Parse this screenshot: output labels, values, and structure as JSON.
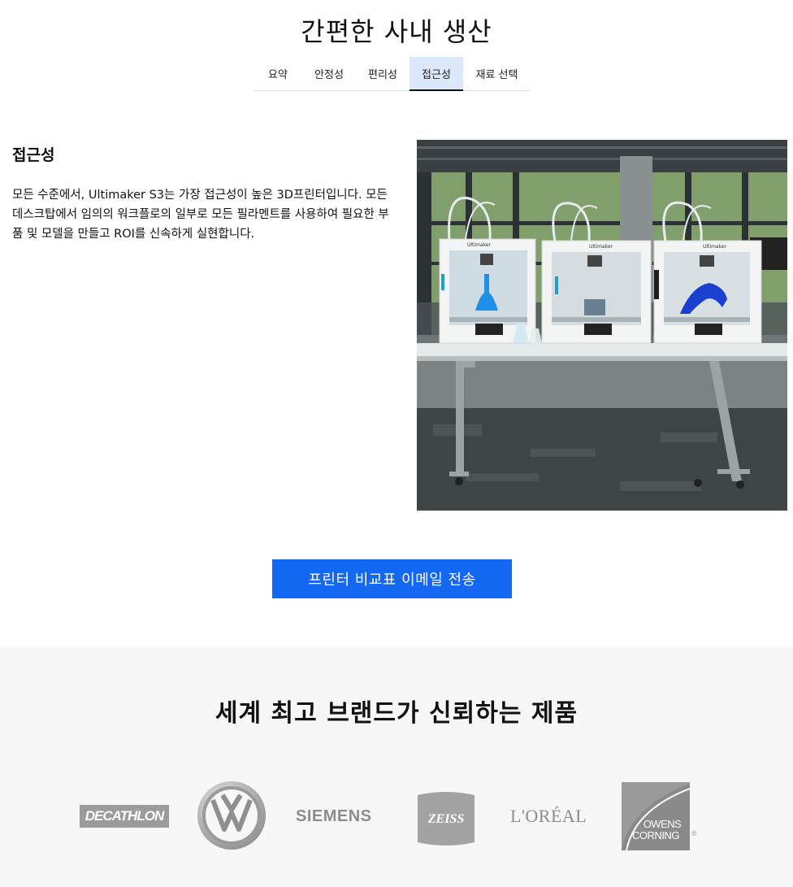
{
  "header": {
    "title": "간편한 사내 생산"
  },
  "tabs": [
    {
      "label": "요약"
    },
    {
      "label": "안정성"
    },
    {
      "label": "편리성"
    },
    {
      "label": "접근성",
      "active": true
    },
    {
      "label": "재료 선택"
    }
  ],
  "section": {
    "heading": "접근성",
    "body": "모든 수준에서,  Ultimaker S3는 가장 접근성이 높은 3D프린터입니다. 모든 데스크탑에서 임의의 워크플로의 일부로 모든 필라멘트를 사용하여 필요한 부품 및 모델을 만들고 ROI를 신속하게 실현합니다."
  },
  "hero_image": {
    "printer_brand_label": "Ultimaker"
  },
  "cta": {
    "label": "프린터 비교표 이메일 전송",
    "color": "#1467f0"
  },
  "brands": {
    "title": "세계 최고 브랜드가 신뢰하는 제품",
    "logos": [
      {
        "name": "decathlon-logo",
        "text": "DECATHLON"
      },
      {
        "name": "volkswagen-logo",
        "text": "VW"
      },
      {
        "name": "siemens-logo",
        "text": "SIEMENS"
      },
      {
        "name": "zeiss-logo",
        "text": "ZEISS"
      },
      {
        "name": "loreal-logo",
        "text": "L'ORÉAL"
      },
      {
        "name": "owens-corning-logo",
        "text_line1": "OWENS",
        "text_line2": "CORNING",
        "mark": "®"
      }
    ]
  }
}
